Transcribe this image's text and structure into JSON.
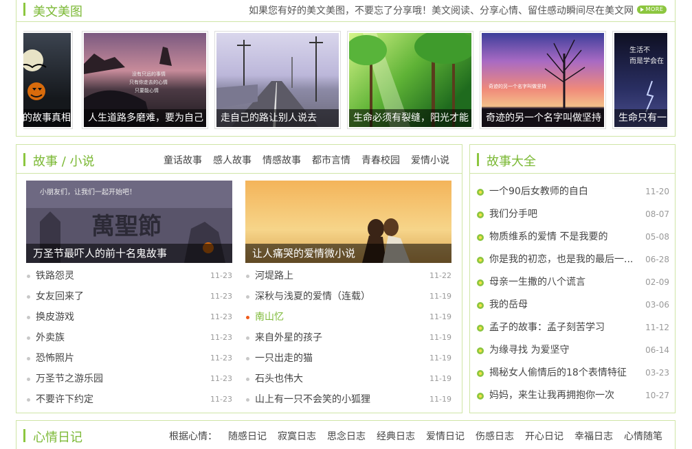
{
  "gallery": {
    "title": "美文美图",
    "slogan": "如果您有好的美文美图，不要忘了分享哦！美文阅读、分享心情、留住感动瞬间尽在美文网",
    "more": "MORE",
    "items": [
      {
        "caption": "的故事真相"
      },
      {
        "caption": "人生道路多磨难，要为自己"
      },
      {
        "caption": "走自己的路让别人说去"
      },
      {
        "caption": "生命必须有裂缝，阳光才能"
      },
      {
        "caption": "奇迹的另一个名字叫做坚持"
      },
      {
        "caption": "生命只有一"
      }
    ]
  },
  "story": {
    "title": "故事 / 小说",
    "tabs": [
      "童话故事",
      "感人故事",
      "情感故事",
      "都市言情",
      "青春校园",
      "爱情小说"
    ],
    "features": [
      {
        "caption": "万圣节最吓人的前十名鬼故事"
      },
      {
        "caption": "让人痛哭的爱情微小说"
      }
    ],
    "left_list": [
      {
        "title": "铁路怨灵",
        "date": "11-23"
      },
      {
        "title": "女友回来了",
        "date": "11-23"
      },
      {
        "title": "换皮游戏",
        "date": "11-23"
      },
      {
        "title": "外卖族",
        "date": "11-23"
      },
      {
        "title": "恐怖照片",
        "date": "11-23"
      },
      {
        "title": "万圣节之游乐园",
        "date": "11-23"
      },
      {
        "title": "不要许下约定",
        "date": "11-23"
      }
    ],
    "right_list": [
      {
        "title": "河堤路上",
        "date": "11-22"
      },
      {
        "title": "深秋与浅夏的爱情（连载）",
        "date": "11-19"
      },
      {
        "title": "南山忆",
        "date": "11-19"
      },
      {
        "title": "来自外星的孩子",
        "date": "11-19"
      },
      {
        "title": "一只出走的猫",
        "date": "11-19"
      },
      {
        "title": "石头也伟大",
        "date": "11-19"
      },
      {
        "title": "山上有一只不会笑的小狐狸",
        "date": "11-19"
      }
    ]
  },
  "side": {
    "title": "故事大全",
    "items": [
      {
        "title": "一个90后女教师的自白",
        "date": "11-20"
      },
      {
        "title": "我们分手吧",
        "date": "08-07"
      },
      {
        "title": "物质维系的爱情 不是我要的",
        "date": "05-08"
      },
      {
        "title": "你是我的初恋，也是我的最后一...",
        "date": "06-28"
      },
      {
        "title": "母亲一生撒的八个谎言",
        "date": "02-09"
      },
      {
        "title": "我的岳母",
        "date": "03-06"
      },
      {
        "title": "孟子的故事：孟子刻苦学习",
        "date": "11-12"
      },
      {
        "title": "为缘寻找 为爱坚守",
        "date": "06-14"
      },
      {
        "title": "揭秘女人偷情后的18个表情特征",
        "date": "03-23"
      },
      {
        "title": "妈妈，来生让我再拥抱你一次",
        "date": "10-27"
      }
    ]
  },
  "diary": {
    "title": "心情日记",
    "label": "根据心情：",
    "tabs": [
      "随感日记",
      "寂寞日志",
      "思念日志",
      "经典日志",
      "爱情日记",
      "伤感日志",
      "开心日记",
      "幸福日志",
      "心情随笔"
    ]
  },
  "colors": {
    "accent": "#8cc63f",
    "title": "#7cb936",
    "highlight_dot": "#f05a1a"
  }
}
